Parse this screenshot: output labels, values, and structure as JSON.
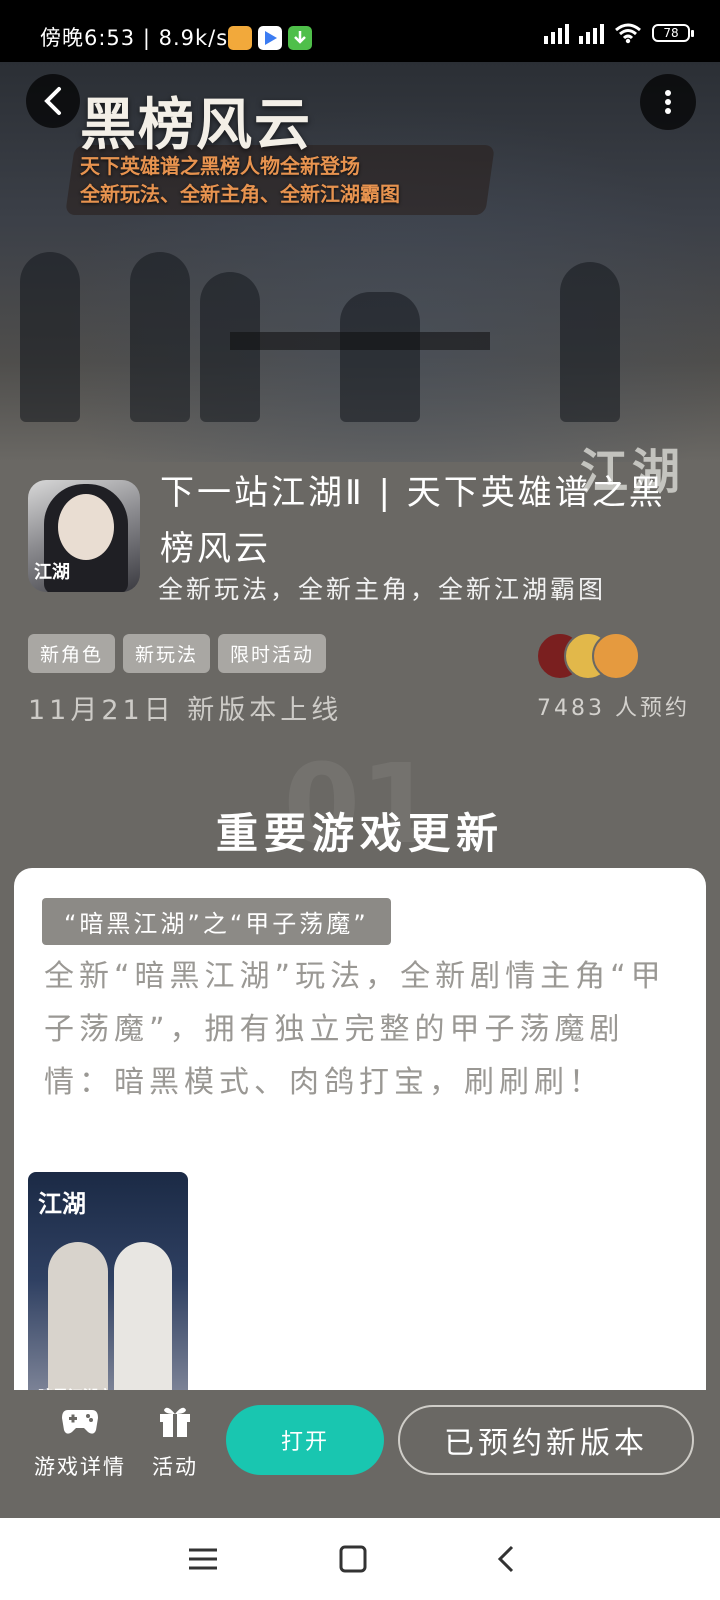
{
  "status_bar": {
    "time": "傍晚6:53 | 8.9k/s",
    "battery": "78"
  },
  "banner": {
    "title": "黑榜风云",
    "subtitle_line1": "天下英雄谱之黑榜人物全新登场",
    "subtitle_line2": "全新玩法、全新主角、全新江湖霸图",
    "watermark": "江湖"
  },
  "game": {
    "icon_text": "江湖",
    "title": "下一站江湖Ⅱ | 天下英雄谱之黑榜风云",
    "subtitle": "全新玩法，全新主角，全新江湖霸图",
    "tags": [
      "新角色",
      "新玩法",
      "限时活动"
    ],
    "release": "11月21日 新版本上线",
    "reservations": "7483 人预约"
  },
  "section": {
    "number": "01",
    "title": "重要游戏更新"
  },
  "update_card": {
    "badge": "“暗黑江湖”之“甲子荡魔”",
    "description": "全新“暗黑江湖”玩法，全新剧情主角“甲子荡魔”，拥有独立完整的甲子荡魔剧情：暗黑模式、肉鸽打宝，刷刷刷！",
    "image_logo": "江湖",
    "image_caption": "暗黑江湖之"
  },
  "action_bar": {
    "details_label": "游戏详情",
    "activity_label": "活动",
    "open_label": "打开",
    "reserved_label": "已预约新版本"
  },
  "colors": {
    "background": "#6a6864",
    "accent": "#19c6b0",
    "tag_bg": "#a9a7a3",
    "banner_subtitle": "#e7934f"
  }
}
